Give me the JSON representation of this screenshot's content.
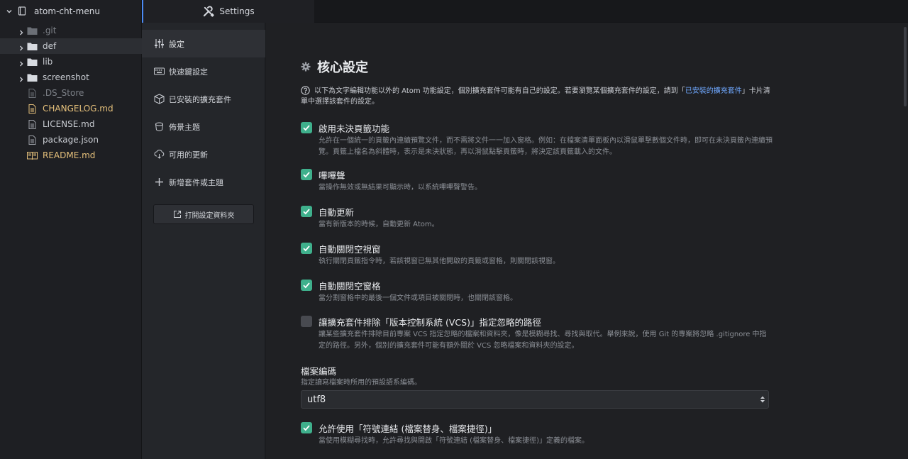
{
  "tree": {
    "root_label": "atom-cht-menu",
    "items": [
      {
        "label": ".git",
        "type": "folder",
        "style": "ignored"
      },
      {
        "label": "def",
        "type": "folder",
        "style": "normal",
        "selected": true
      },
      {
        "label": "lib",
        "type": "folder",
        "style": "normal"
      },
      {
        "label": "screenshot",
        "type": "folder",
        "style": "normal"
      },
      {
        "label": ".DS_Store",
        "type": "file",
        "style": "ignored"
      },
      {
        "label": "CHANGELOG.md",
        "type": "file",
        "style": "modified"
      },
      {
        "label": "LICENSE.md",
        "type": "file",
        "style": "normal"
      },
      {
        "label": "package.json",
        "type": "file",
        "style": "normal"
      },
      {
        "label": "README.md",
        "type": "book",
        "style": "modified"
      }
    ]
  },
  "tabs": [
    {
      "label": "Settings",
      "icon": "tools-icon",
      "active": true
    }
  ],
  "settings_menu": {
    "items": [
      {
        "label": "設定",
        "icon": "sliders-icon",
        "active": true
      },
      {
        "label": "快速鍵設定",
        "icon": "keyboard-icon"
      },
      {
        "label": "已安裝的擴充套件",
        "icon": "package-icon"
      },
      {
        "label": "佈景主題",
        "icon": "paintcan-icon"
      },
      {
        "label": "可用的更新",
        "icon": "cloud-download-icon"
      },
      {
        "label": "新增套件或主題",
        "icon": "plus-icon"
      }
    ],
    "open_config_label": "打開設定資料夾"
  },
  "core": {
    "title": "核心設定",
    "intro_text": "以下為文字編輯功能以外的 Atom 功能設定，個別擴充套件可能有自己的設定。若要瀏覽某個擴充套件的設定，請到「",
    "intro_link": "已安裝的擴充套件",
    "intro_suffix": "」卡片清單中選擇該套件的設定。",
    "options": [
      {
        "title": "啟用未決頁籤功能",
        "checked": true,
        "desc": "允許在一個統一的頁籤內連續預覽文件，而不需將文件一一加入窗格。例如：在檔案清單面板內以滑鼠單擊數個文件時，即可在未決頁籤內連續預覽。頁籤上檔名為斜體時，表示是未決狀態，再以滑鼠點擊頁籤時，將決定該頁籤載入的文件。"
      },
      {
        "title": "嗶嗶聲",
        "checked": true,
        "desc": "當操作無效或無結果可顯示時，以系統嗶嗶聲警告。"
      },
      {
        "title": "自動更新",
        "checked": true,
        "desc": "當有新版本的時候，自動更新 Atom。"
      },
      {
        "title": "自動關閉空視窗",
        "checked": true,
        "desc": "執行關閉頁籤指令時，若該視窗已無其他開啟的頁籤或窗格，則關閉該視窗。"
      },
      {
        "title": "自動關閉空窗格",
        "checked": true,
        "desc": "當分割窗格中的最後一個文件或項目被關閉時，也關閉該窗格。"
      },
      {
        "title": "讓擴充套件排除「版本控制系統 (VCS)」指定忽略的路徑",
        "checked": false,
        "desc": "讓某些擴充套件排除目前專案 VCS 指定忽略的檔案和資料夾，像是模糊尋找、尋找與取代。舉例來說，使用 Git 的專案將忽略 .gitignore 中指定的路徑。另外，個別的擴充套件可能有額外關於 VCS 忽略檔案和資料夾的設定。"
      }
    ],
    "encoding": {
      "title": "檔案編碼",
      "desc": "指定讀寫檔案時所用的預設語系編碼。",
      "value": "utf8"
    },
    "symlink_option": {
      "title": "允許使用「符號連結 (檔案替身、檔案捷徑)」",
      "checked": true,
      "desc": "當使用模糊尋找時，允許尋找與開啟「符號連結 (檔案替身、檔案捷徑)」定義的檔案。"
    }
  }
}
